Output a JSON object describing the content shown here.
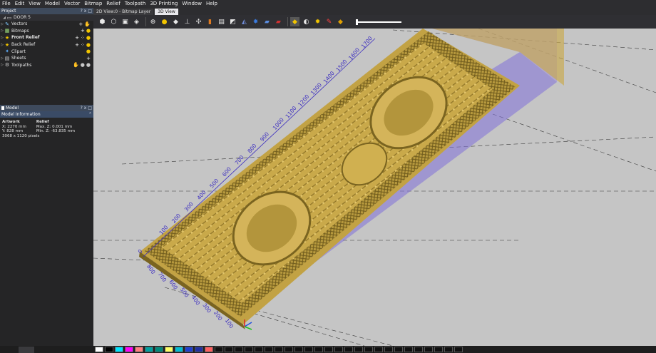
{
  "menu": [
    "File",
    "Edit",
    "View",
    "Model",
    "Vector",
    "Bitmap",
    "Relief",
    "Toolpath",
    "3D Printing",
    "Window",
    "Help"
  ],
  "project_panel": {
    "title": "Project",
    "controls": [
      "?",
      "x",
      "□"
    ],
    "project_name": "DOOR 5",
    "items": [
      {
        "label": "Vectors",
        "icon": "vectors-icon",
        "bold": false
      },
      {
        "label": "Bitmaps",
        "icon": "bitmaps-icon",
        "bold": false
      },
      {
        "label": "Front Relief",
        "icon": "star-icon",
        "bold": true
      },
      {
        "label": "Back Relief",
        "icon": "star-icon",
        "bold": false
      },
      {
        "label": "Clipart",
        "icon": "clipart-icon",
        "bold": false
      },
      {
        "label": "Sheets",
        "icon": "sheets-icon",
        "bold": false
      },
      {
        "label": "Toolpaths",
        "icon": "toolpaths-icon",
        "bold": false
      }
    ]
  },
  "model_panel": {
    "title": "Model",
    "section_title": "Model Information",
    "artwork_heading": "Artwork",
    "artwork_x": "X: 2270 mm",
    "artwork_y": "Y: 828 mm",
    "artwork_pixels": "3068 x 1120 pixels",
    "relief_heading": "Relief",
    "relief_max": "Max. Z: 0.001 mm",
    "relief_min": "Min. Z: -63.835 mm"
  },
  "tabs": [
    {
      "label": "2D View:0 - Bitmap Layer",
      "active": false
    },
    {
      "label": "3D View",
      "active": true
    }
  ],
  "ruler_long": [
    "100",
    "200",
    "300",
    "400",
    "500",
    "600",
    "700",
    "800",
    "900",
    "1000",
    "1100",
    "1200",
    "1300",
    "1400",
    "1500",
    "1600",
    "1700"
  ],
  "ruler_short": [
    "100",
    "200",
    "300",
    "400",
    "500",
    "600",
    "700",
    "800"
  ],
  "ruler_origin": "0",
  "colors": {
    "relief": "#c9a94a",
    "relief_dark": "#7a6420",
    "viewport_bg": "#c5c5c5",
    "bounding_box": "#6b5bd6",
    "ruler_text": "#3a2cc0"
  },
  "palette": [
    "#ffffff",
    "#000000",
    "#00e5ff",
    "#ff00ff",
    "#ff7f7f",
    "#00a0a0",
    "#00897b",
    "#ffff66",
    "#00bcd4",
    "#1e3fd0",
    "#2030a0",
    "#ff6060",
    "#111111",
    "#111111",
    "#111111",
    "#111111",
    "#111111",
    "#111111",
    "#111111",
    "#111111",
    "#111111",
    "#111111",
    "#111111",
    "#111111",
    "#111111",
    "#111111",
    "#111111",
    "#111111",
    "#111111",
    "#111111",
    "#111111",
    "#111111",
    "#111111",
    "#111111",
    "#111111",
    "#111111",
    "#111111"
  ]
}
